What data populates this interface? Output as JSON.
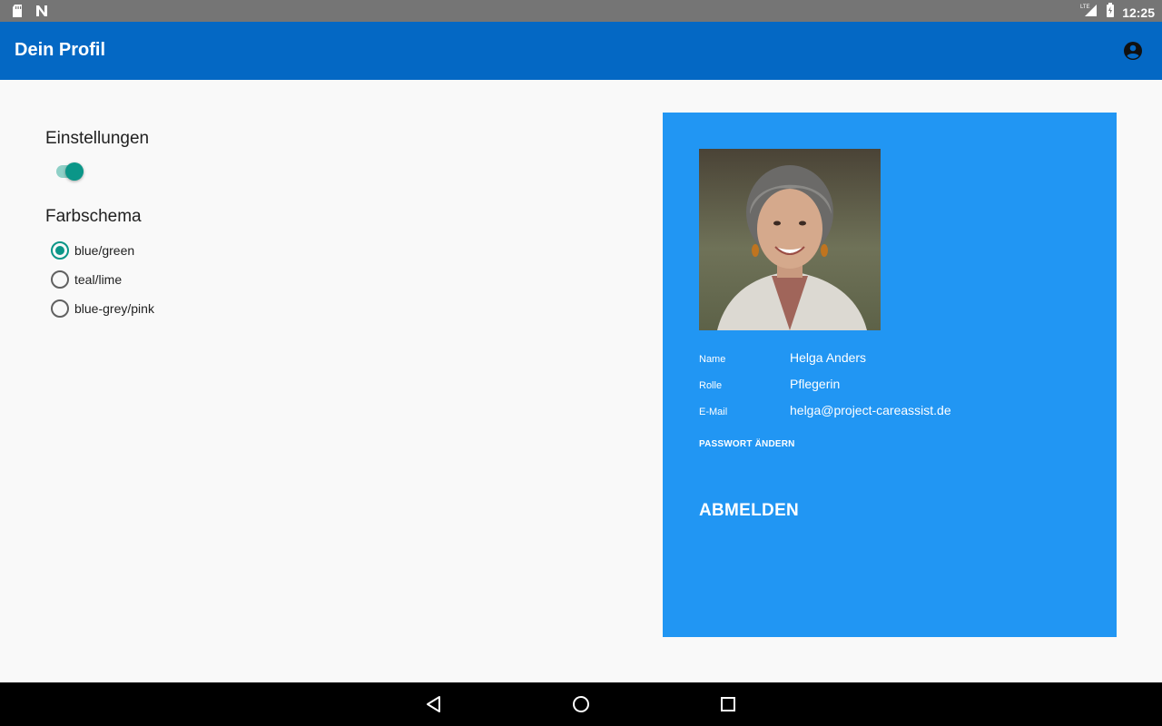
{
  "status_bar": {
    "time": "12:25",
    "icons": [
      "sd-card-icon",
      "notification-n-icon",
      "lte-signal-icon",
      "battery-icon"
    ]
  },
  "app_bar": {
    "title": "Dein Profil",
    "action_icon": "account-circle-icon"
  },
  "settings": {
    "title": "Einstellungen",
    "toggle_on": true,
    "color_scheme": {
      "title": "Farbschema",
      "options": [
        {
          "label": "blue/green",
          "selected": true
        },
        {
          "label": "teal/lime",
          "selected": false
        },
        {
          "label": "blue-grey/pink",
          "selected": false
        }
      ]
    }
  },
  "profile": {
    "fields": [
      {
        "label": "Name",
        "value": "Helga Anders"
      },
      {
        "label": "Rolle",
        "value": "Pflegerin"
      },
      {
        "label": "E-Mail",
        "value": "helga@project-careassist.de"
      }
    ],
    "change_password_label": "PASSWORT ÄNDERN",
    "logout_label": "ABMELDEN"
  },
  "colors": {
    "app_bar": "#0468c4",
    "card": "#2196f3",
    "accent": "#0b9688",
    "status_bar": "#757575"
  },
  "nav_bar": {
    "icons": [
      "back-icon",
      "home-icon",
      "recents-icon"
    ]
  }
}
